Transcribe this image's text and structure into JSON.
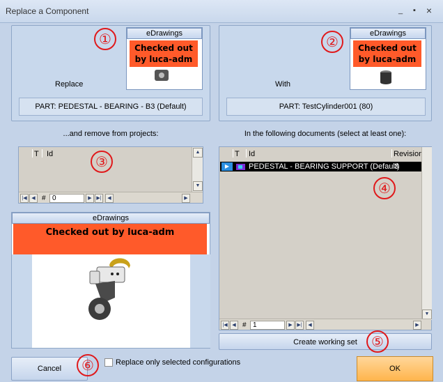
{
  "window": {
    "title": "Replace a Component",
    "minimize": "_",
    "maximize": "▪",
    "close": "×"
  },
  "replace": {
    "edrawings_header": "eDrawings",
    "checked_out": "Checked out by luca-adm",
    "label": "Replace",
    "part": "PART: PEDESTAL - BEARING - B3 (Default)"
  },
  "with": {
    "edrawings_header": "eDrawings",
    "checked_out": "Checked out by luca-adm",
    "label": "With",
    "part": "PART: TestCylinder001 (80)"
  },
  "remove_projects": {
    "label": "...and remove from projects:",
    "columns": [
      "T",
      "Id"
    ],
    "nav_hash": "#",
    "nav_value": "0"
  },
  "documents": {
    "label": "In the following documents (select at least one):",
    "columns": [
      "T",
      "Id",
      "Revision"
    ],
    "rows": [
      {
        "id": "PEDESTAL - BEARING SUPPORT (Default)",
        "revision": "3"
      }
    ],
    "nav_hash": "#",
    "nav_value": "1"
  },
  "preview": {
    "edrawings_header": "eDrawings",
    "checked_out": "Checked out by luca-adm"
  },
  "buttons": {
    "create_working_set": "Create working set",
    "cancel": "Cancel",
    "ok": "OK"
  },
  "checkbox": {
    "label": "Replace only selected configurations",
    "checked": false
  },
  "annotations": [
    "①",
    "②",
    "③",
    "④",
    "⑤",
    "⑥"
  ],
  "colors": {
    "accent_orange": "#ff5a2a",
    "ok_button": "#ffb54c",
    "panel_bg": "#c8d8ec",
    "annotation_red": "#e0191b"
  }
}
